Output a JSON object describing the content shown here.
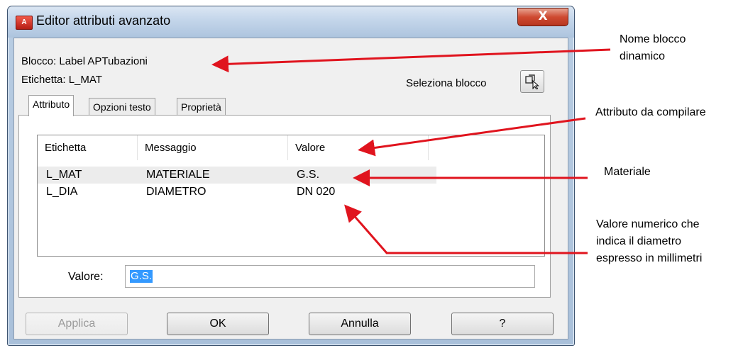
{
  "window": {
    "app_icon": "A",
    "title": "Editor attributi avanzato",
    "close_glyph": "X"
  },
  "header": {
    "blocco_line": "Blocco:   Label APTubazioni",
    "etichetta_line": "Etichetta: L_MAT",
    "seleziona_label": "Seleziona blocco",
    "seleziona_icon": "pick-block-icon"
  },
  "tabs": [
    {
      "label": "Attributo",
      "active": true
    },
    {
      "label": "Opzioni testo",
      "active": false
    },
    {
      "label": "Proprietà",
      "active": false
    }
  ],
  "attribute_list": {
    "columns": [
      "Etichetta",
      "Messaggio",
      "Valore"
    ],
    "rows": [
      {
        "etichetta": "L_MAT",
        "messaggio": "MATERIALE",
        "valore": "G.S.",
        "selected": true
      },
      {
        "etichetta": "L_DIA",
        "messaggio": "DIAMETRO",
        "valore": "DN 020",
        "selected": false
      }
    ]
  },
  "valore_field": {
    "label": "Valore:",
    "value": "G.S."
  },
  "buttons": {
    "applica": "Applica",
    "ok": "OK",
    "annulla": "Annulla",
    "help": "?"
  },
  "annotations": {
    "nome_blocco_line1": "Nome blocco",
    "nome_blocco_line2": "dinamico",
    "attributo": "Attributo da compilare",
    "materiale": "Materiale",
    "valore_line1": "Valore numerico che",
    "valore_line2": "indica il diametro",
    "valore_line3": "espresso in millimetri"
  },
  "colors": {
    "arrow": "#e0141e",
    "selection": "#3399ff",
    "title_bar": "#c3d5ea",
    "close_button": "#cf4a31"
  }
}
